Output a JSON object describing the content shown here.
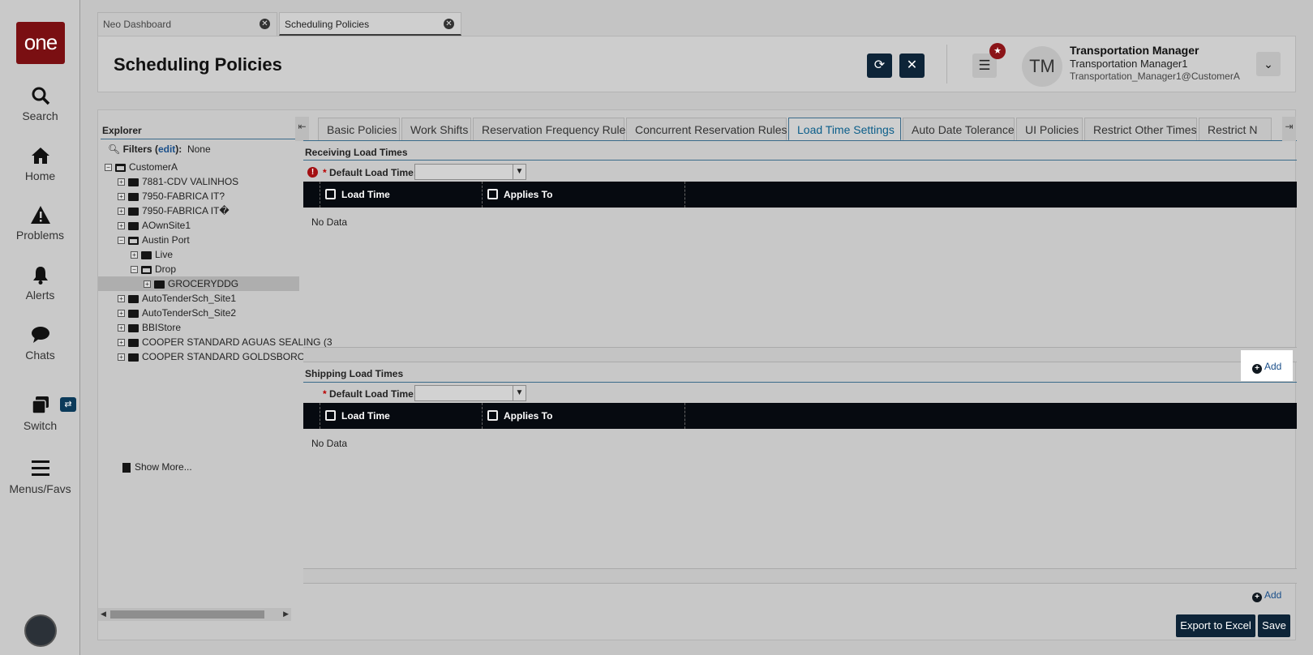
{
  "nav": {
    "logo": "one",
    "items": [
      {
        "label": "Search",
        "icon": "search-icon"
      },
      {
        "label": "Home",
        "icon": "home-icon"
      },
      {
        "label": "Problems",
        "icon": "warning-icon"
      },
      {
        "label": "Alerts",
        "icon": "bell-icon"
      },
      {
        "label": "Chats",
        "icon": "chat-icon"
      },
      {
        "label": "Switch",
        "icon": "switch-icon"
      },
      {
        "label": "Menus/Favs",
        "icon": "hamburger-icon"
      }
    ]
  },
  "tabs": [
    {
      "label": "Neo Dashboard",
      "active": false
    },
    {
      "label": "Scheduling Policies",
      "active": true
    }
  ],
  "header": {
    "title": "Scheduling Policies",
    "user": {
      "initials": "TM",
      "name": "Transportation Manager",
      "role": "Transportation Manager1",
      "email": "Transportation_Manager1@CustomerA"
    }
  },
  "explorer": {
    "title": "Explorer",
    "filters_label": "Filters",
    "filters_edit": "edit",
    "filters_value": "None",
    "tree": [
      {
        "label": "CustomerA",
        "depth": 0,
        "expander": "−",
        "open": true
      },
      {
        "label": "7881-CDV VALINHOS",
        "depth": 1,
        "expander": "+"
      },
      {
        "label": "7950-FABRICA IT?",
        "depth": 1,
        "expander": "+"
      },
      {
        "label": "7950-FABRICA IT�",
        "depth": 1,
        "expander": "+"
      },
      {
        "label": "AOwnSite1",
        "depth": 1,
        "expander": "+"
      },
      {
        "label": "Austin Port",
        "depth": 1,
        "expander": "−",
        "open": true
      },
      {
        "label": "Live",
        "depth": 2,
        "expander": "+"
      },
      {
        "label": "Drop",
        "depth": 2,
        "expander": "−",
        "open": true
      },
      {
        "label": "GROCERYDDG",
        "depth": 3,
        "expander": "+",
        "selected": true
      },
      {
        "label": "AutoTenderSch_Site1",
        "depth": 1,
        "expander": "+"
      },
      {
        "label": "AutoTenderSch_Site2",
        "depth": 1,
        "expander": "+"
      },
      {
        "label": "BBIStore",
        "depth": 1,
        "expander": "+"
      },
      {
        "label": "COOPER STANDARD AGUAS SEALING (3",
        "depth": 1,
        "expander": "+"
      },
      {
        "label": "COOPER STANDARD GOLDSBORO",
        "depth": 1,
        "expander": "+"
      }
    ],
    "show_more": "Show More..."
  },
  "policy_tabs": [
    "Basic Policies",
    "Work Shifts",
    "Reservation Frequency Rules",
    "Concurrent Reservation Rules",
    "Load Time Settings",
    "Auto Date Tolerance",
    "UI Policies",
    "Restrict Other Times",
    "Restrict N"
  ],
  "active_policy_tab": "Load Time Settings",
  "receiving": {
    "title": "Receiving Load Times",
    "field_label": "Default Load Time:",
    "required_mark": "*",
    "value": "",
    "columns": [
      "Load Time",
      "Applies To"
    ],
    "empty_text": "No Data",
    "add_label": "Add"
  },
  "shipping": {
    "title": "Shipping Load Times",
    "field_label": "Default Load Time:",
    "required_mark": "*",
    "value": "",
    "columns": [
      "Load Time",
      "Applies To"
    ],
    "empty_text": "No Data",
    "add_label": "Add"
  },
  "footer": {
    "export_label": "Export to Excel",
    "save_label": "Save"
  },
  "colors": {
    "logo_bg": "#7a0f12",
    "button_dark": "#0d2438",
    "grid_header": "#060a10",
    "active_tab_text": "#0b5e8a",
    "error_red": "#a30f12"
  }
}
